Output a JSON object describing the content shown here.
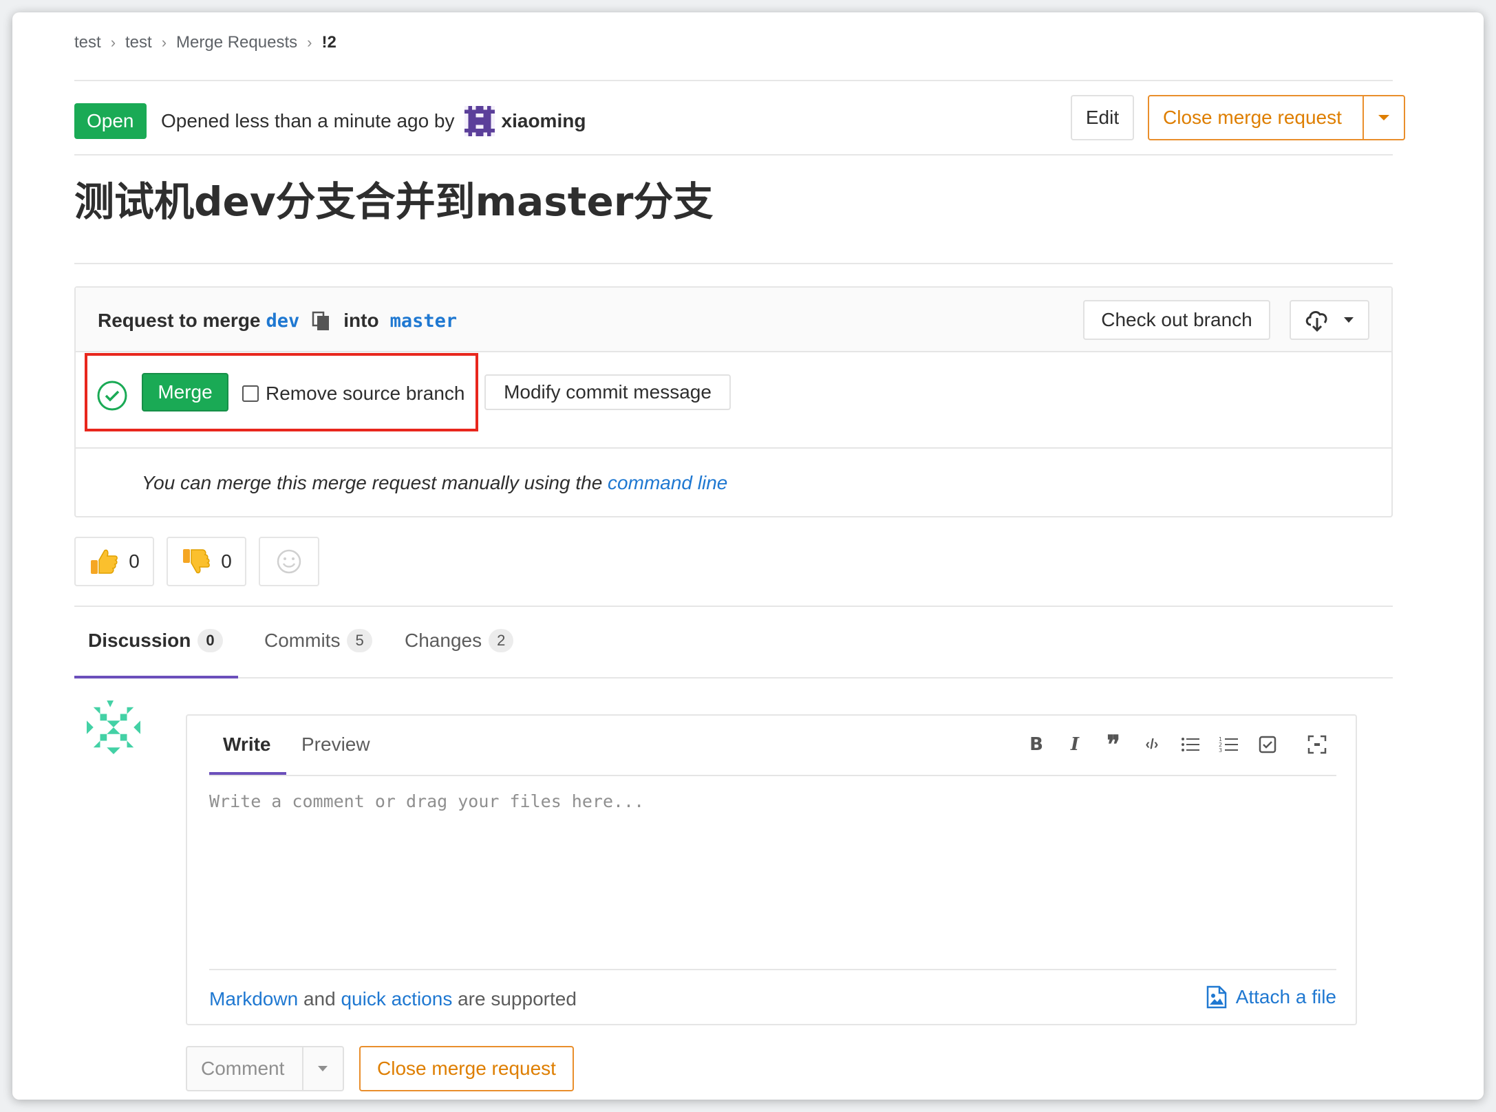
{
  "breadcrumb": [
    "test",
    "test",
    "Merge Requests",
    "!2"
  ],
  "header": {
    "status": "Open",
    "opened_text": "Opened less than a minute ago by",
    "author": "xiaoming",
    "edit_label": "Edit",
    "close_label": "Close merge request"
  },
  "title": "测试机dev分支合并到master分支",
  "merge_widget": {
    "request_text": "Request to merge",
    "source_branch": "dev",
    "into_text": "into",
    "target_branch": "master",
    "checkout_label": "Check out branch",
    "merge_label": "Merge",
    "remove_source_label": "Remove source branch",
    "modify_commit_label": "Modify commit message",
    "manual_text": "You can merge this merge request manually using the",
    "command_line_link": "command line"
  },
  "awards": {
    "thumbs_up_count": "0",
    "thumbs_down_count": "0"
  },
  "tabs": [
    {
      "label": "Discussion",
      "count": "0"
    },
    {
      "label": "Commits",
      "count": "5"
    },
    {
      "label": "Changes",
      "count": "2"
    }
  ],
  "editor": {
    "write_tab": "Write",
    "preview_tab": "Preview",
    "placeholder": "Write a comment or drag your files here...",
    "markdown_link": "Markdown",
    "and_text": "and",
    "quick_actions_link": "quick actions",
    "supported_text": "are supported",
    "attach_label": "Attach a file",
    "toolbar": [
      "bold-icon",
      "italic-icon",
      "quote-icon",
      "code-icon",
      "bullet-list-icon",
      "numbered-list-icon",
      "task-list-icon",
      "fullscreen-icon"
    ]
  },
  "actions": {
    "comment_label": "Comment",
    "close_label": "Close merge request"
  },
  "colors": {
    "success": "#1aaa55",
    "warning": "#de7e00",
    "link": "#1f78d1",
    "tab_active": "#6b4fbb",
    "highlight": "#e8271d"
  }
}
